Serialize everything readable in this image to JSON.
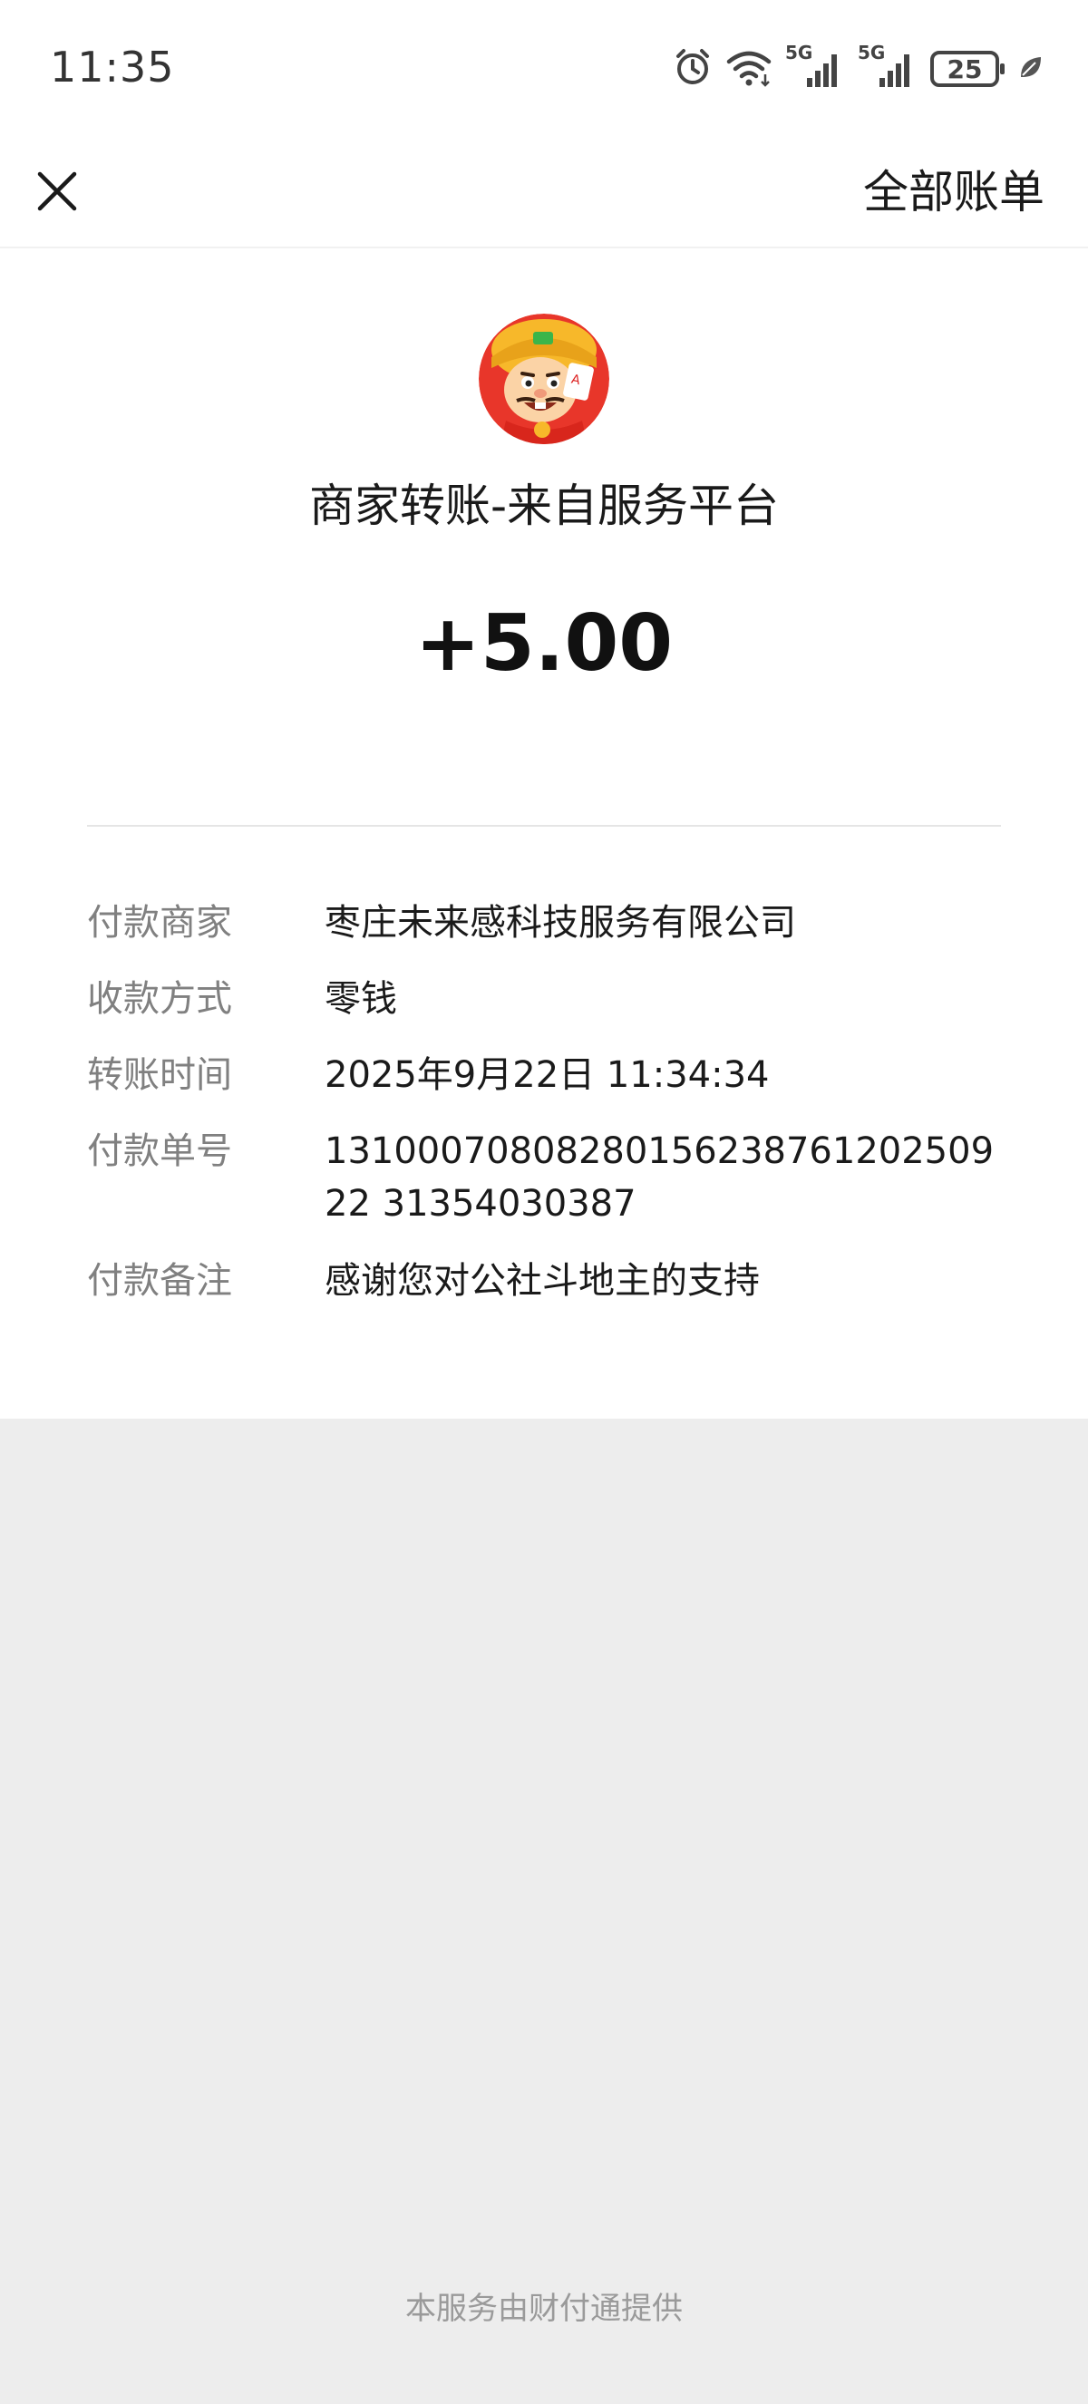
{
  "status_bar": {
    "time": "11:35",
    "network_1": "5G",
    "network_2": "5G",
    "battery": "25",
    "icons": [
      "alarm-icon",
      "wifi-icon",
      "signal-icon",
      "signal-icon",
      "battery-icon",
      "leaf-icon"
    ]
  },
  "nav": {
    "close_icon": "close-icon",
    "all_bills_label": "全部账单"
  },
  "header": {
    "avatar_icon": "merchant-avatar",
    "title": "商家转账-来自服务平台",
    "amount": "+5.00"
  },
  "details": [
    {
      "label": "付款商家",
      "value": "枣庄未来感科技服务有限公司"
    },
    {
      "label": "收款方式",
      "value": "零钱"
    },
    {
      "label": "转账时间",
      "value": "2025年9月22日 11:34:34"
    },
    {
      "label": "付款单号",
      "value": "1310007080828015623876120250922 31354030387"
    },
    {
      "label": "付款备注",
      "value": "感谢您对公社斗地主的支持"
    }
  ],
  "footer": {
    "text": "本服务由财付通提供"
  },
  "colors": {
    "background": "#ededed",
    "card": "#ffffff",
    "label": "#808080",
    "text": "#1a1a1a",
    "footer": "#9a9a9a"
  }
}
